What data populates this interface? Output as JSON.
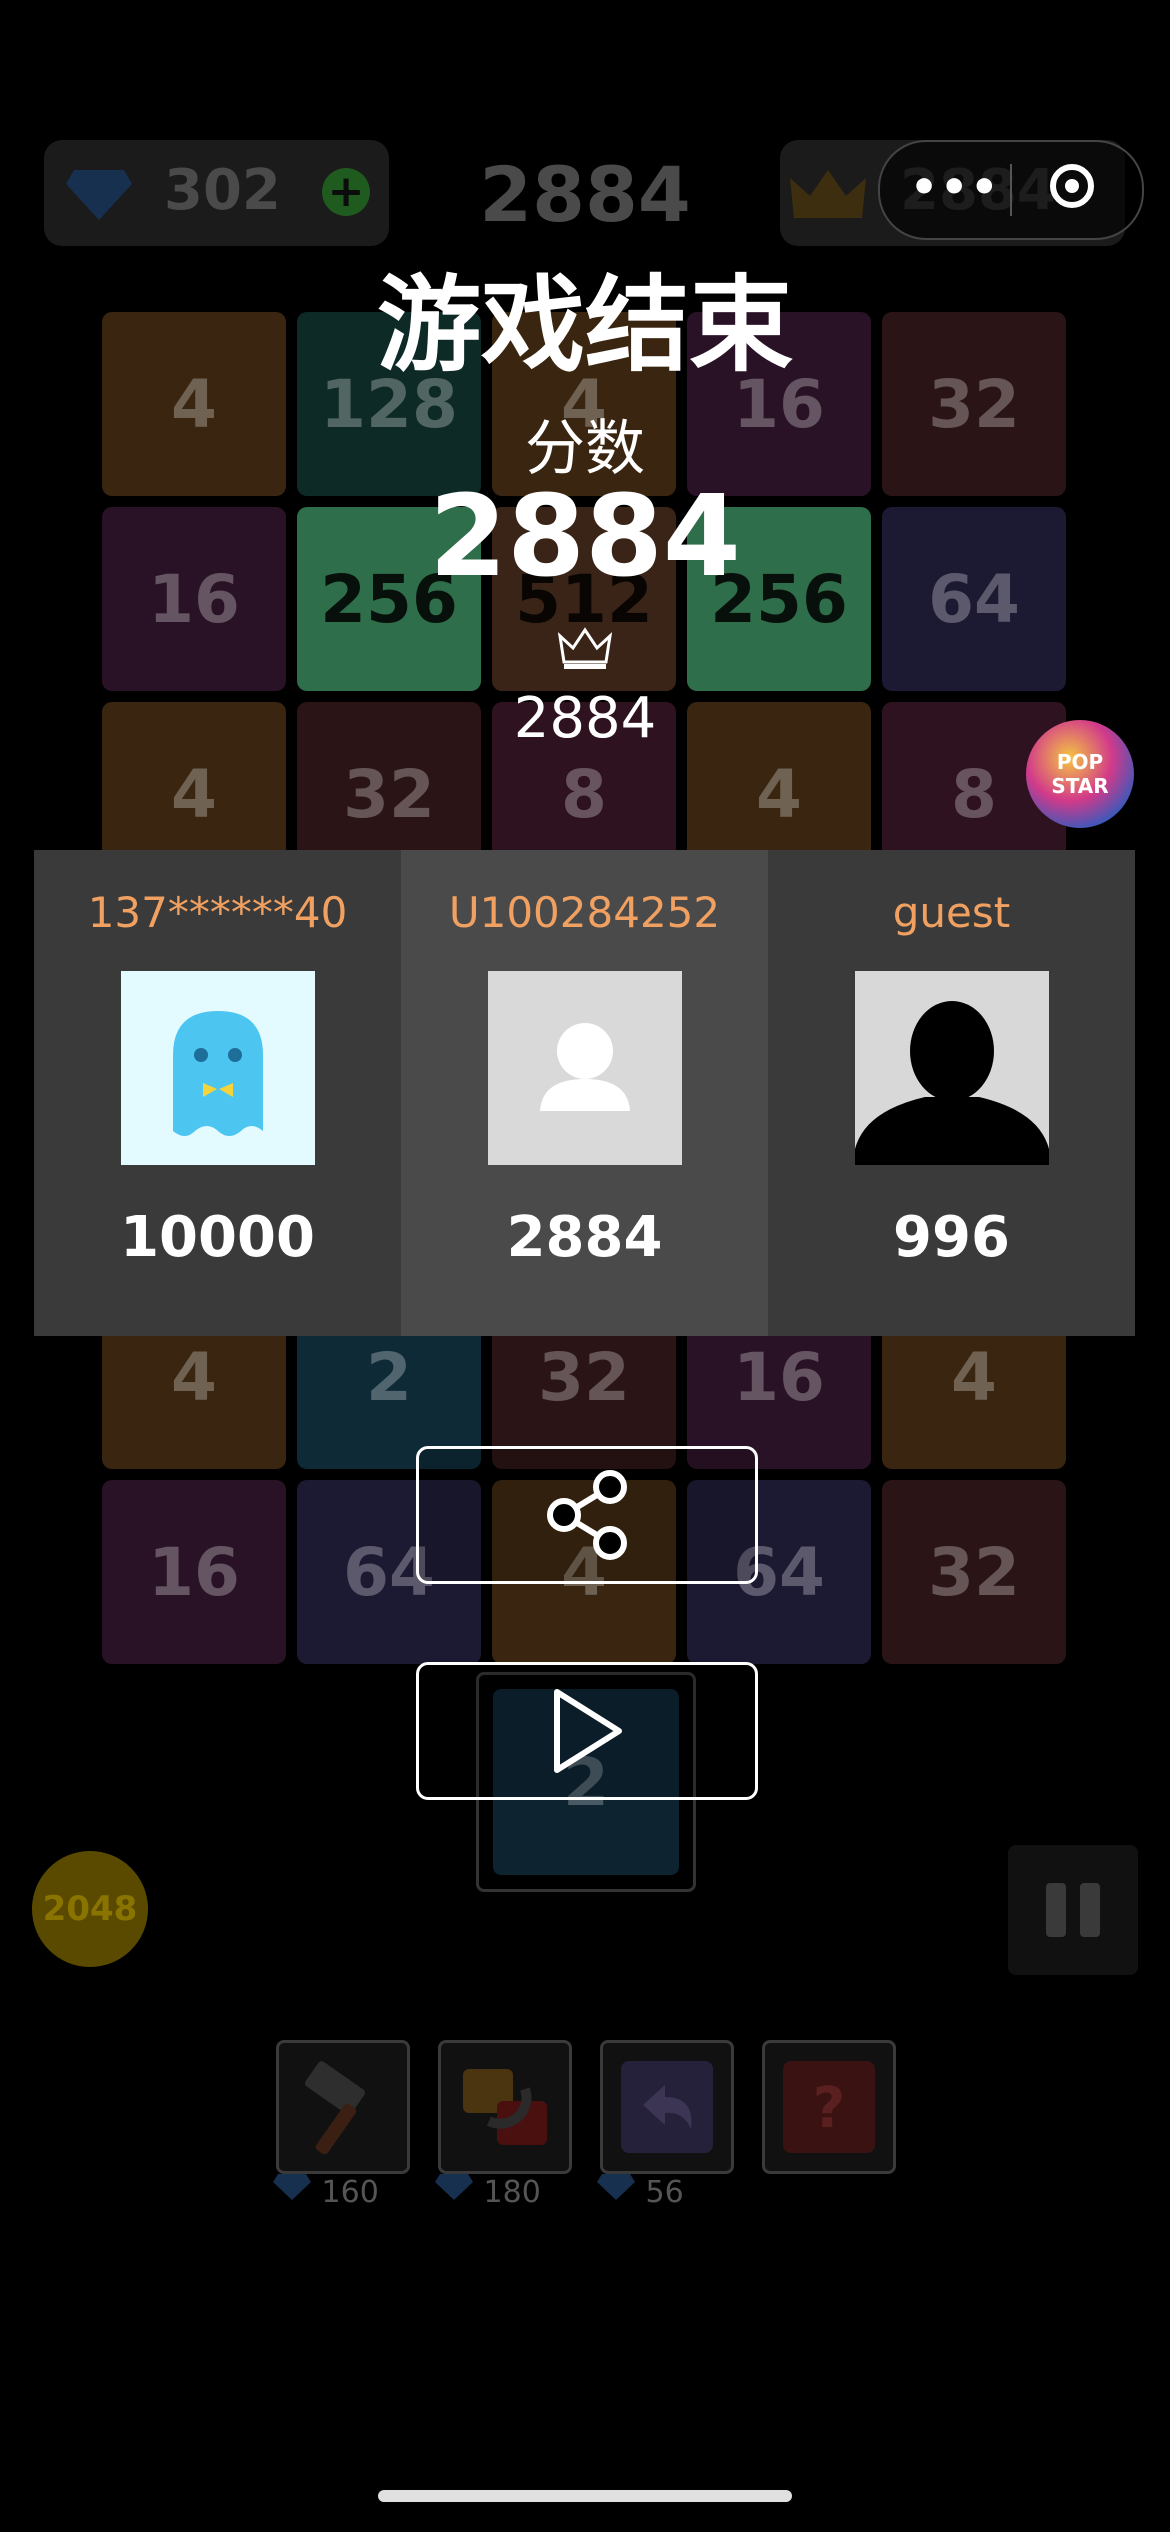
{
  "top_bar": {
    "gems": "302",
    "current_score": "2884",
    "best_score": "2884"
  },
  "board": {
    "rows": [
      [
        "4",
        "128",
        "4",
        "16",
        "32"
      ],
      [
        "16",
        "256",
        "512",
        "256",
        "64"
      ],
      [
        "4",
        "32",
        "8",
        "4",
        "8"
      ],
      [
        "",
        "",
        "",
        "",
        ""
      ],
      [
        "4",
        "2",
        "32",
        "16",
        "4"
      ],
      [
        "16",
        "64",
        "4",
        "64",
        "32"
      ]
    ],
    "next_tile": "2"
  },
  "game_over": {
    "title": "游戏结束",
    "score_label": "分数",
    "score": "2884",
    "best_icon": "crown-icon",
    "best": "2884"
  },
  "leaderboard": [
    {
      "name": "137******40",
      "avatar": "ghost-avatar",
      "score": "10000"
    },
    {
      "name": "U100284252",
      "avatar": "default-person-avatar",
      "score": "2884"
    },
    {
      "name": "guest",
      "avatar": "silhouette-avatar",
      "score": "996"
    }
  ],
  "buttons": {
    "share_icon": "share-icon",
    "play_icon": "play-icon"
  },
  "side": {
    "badge_2048": "2048",
    "popstar_logo": "POP STAR"
  },
  "tools": [
    {
      "icon": "hammer-icon",
      "cost": "160"
    },
    {
      "icon": "swap-icon",
      "cost": "180"
    },
    {
      "icon": "undo-icon",
      "cost": "56"
    },
    {
      "icon": "question-icon",
      "cost": ""
    }
  ],
  "colors": {
    "accent_orange": "#f0a060",
    "panel_left": "#3a3a3a",
    "panel_mid": "#4a4a4a",
    "panel_right": "#3a3a3a"
  }
}
